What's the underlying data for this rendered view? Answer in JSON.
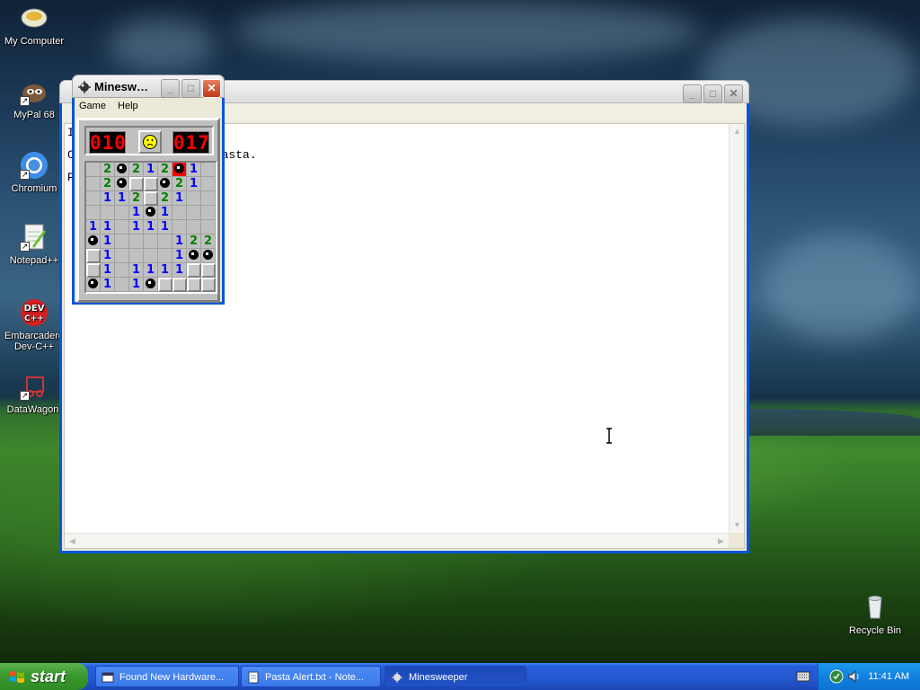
{
  "desktop": {
    "icons": [
      {
        "label": "My Computer"
      },
      {
        "label": "MyPal 68"
      },
      {
        "label": "Chromium"
      },
      {
        "label": "Notepad++"
      },
      {
        "label": "Embarcadero Dev-C++"
      },
      {
        "label": "DataWagon."
      },
      {
        "label": "Recycle Bin"
      }
    ]
  },
  "notepad": {
    "visible_text": [
      "I",
      "C                    pasta.",
      "P"
    ]
  },
  "minesweeper": {
    "title": "Minesweeper",
    "menu": [
      "Game",
      "Help"
    ],
    "mine_counter": "010",
    "timer": "017",
    "face": "sad",
    "grid": [
      [
        "",
        "2",
        "*",
        "2",
        "1",
        "2",
        "X",
        "1",
        ""
      ],
      [
        "",
        "2",
        "*",
        "#",
        "#",
        "*",
        "2",
        "1",
        ""
      ],
      [
        "",
        "1",
        "1",
        "2",
        "#",
        "2",
        "1",
        "",
        ""
      ],
      [
        "",
        "",
        "",
        "1",
        "*",
        "1",
        "",
        "",
        ""
      ],
      [
        "1",
        "1",
        "",
        "1",
        "1",
        "1",
        "",
        "",
        ""
      ],
      [
        "*",
        "1",
        "",
        "",
        "",
        "",
        "1",
        "2",
        "2"
      ],
      [
        "#",
        "1",
        "",
        "",
        "",
        "",
        "1",
        "*",
        "*"
      ],
      [
        "#",
        "1",
        "",
        "1",
        "1",
        "1",
        "1",
        "#",
        "#"
      ],
      [
        "*",
        "1",
        "",
        "1",
        "*",
        "#",
        "#",
        "#",
        "#"
      ]
    ],
    "colors": {
      "1": "#0000ff",
      "2": "#008000"
    }
  },
  "taskbar": {
    "start_label": "start",
    "tasks": [
      {
        "label": "Found New Hardware..."
      },
      {
        "label": "Pasta Alert.txt - Note..."
      },
      {
        "label": "Minesweeper"
      }
    ],
    "clock": "11:41 AM"
  }
}
